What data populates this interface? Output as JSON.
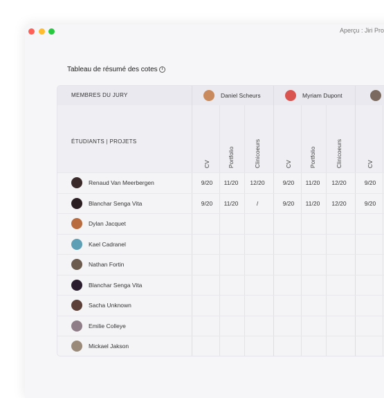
{
  "window": {
    "title": "Aperçu : Jiri Pro"
  },
  "page": {
    "title": "Tableau de résumé des cotes"
  },
  "table": {
    "jury_label": "MEMBRES DU JURY",
    "students_label": "ÉTUDIANTS | PROJETS",
    "jurors": [
      {
        "name": "Daniel Scheurs",
        "avatar_color": "#c98a5e"
      },
      {
        "name": "Myriam Dupont",
        "avatar_color": "#d9534f"
      },
      {
        "name": "",
        "avatar_color": "#7a6a5f"
      }
    ],
    "columns": [
      "CV",
      "Portfolio",
      "Clinicoeurs",
      "CV",
      "Portfolio",
      "Clinicoeurs",
      "CV"
    ],
    "students": [
      {
        "name": "Renaud Van Meerbergen",
        "avatar_color": "#3a2a2a",
        "grades": [
          "9/20",
          "11/20",
          "12/20",
          "9/20",
          "11/20",
          "12/20",
          "9/20"
        ]
      },
      {
        "name": "Blanchar Senga Vita",
        "avatar_color": "#2a1e22",
        "grades": [
          "9/20",
          "11/20",
          "/",
          "9/20",
          "11/20",
          "12/20",
          "9/20"
        ]
      },
      {
        "name": "Dylan Jacquet",
        "avatar_color": "#b86b3e",
        "grades": []
      },
      {
        "name": "Kael Cadranel",
        "avatar_color": "#5f9fb5",
        "grades": []
      },
      {
        "name": "Nathan Fortin",
        "avatar_color": "#6b5a4e",
        "grades": []
      },
      {
        "name": "Blanchar Senga Vita",
        "avatar_color": "#2a1e2e",
        "grades": []
      },
      {
        "name": "Sacha Unknown",
        "avatar_color": "#5a4038",
        "grades": []
      },
      {
        "name": "Emilie Colleye",
        "avatar_color": "#8f7d88",
        "grades": []
      },
      {
        "name": "Mickael Jakson",
        "avatar_color": "#9a8a7a",
        "grades": []
      }
    ]
  }
}
